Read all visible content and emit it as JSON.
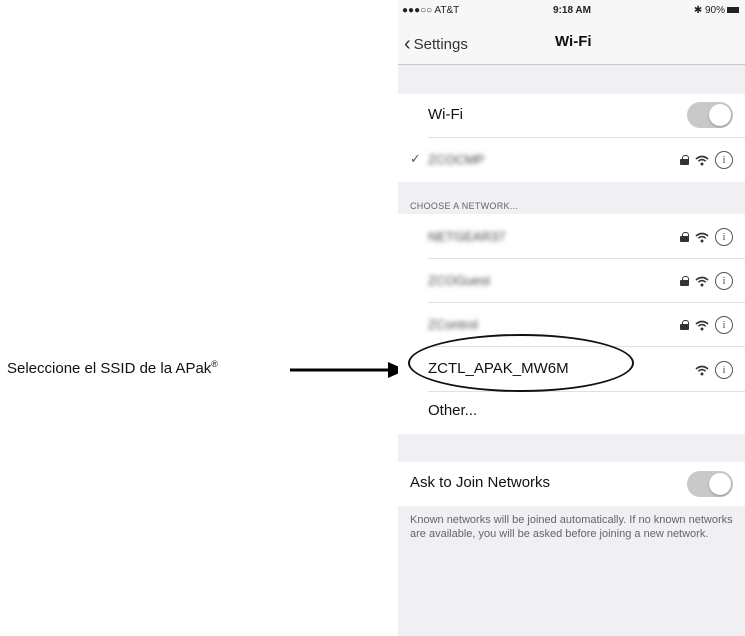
{
  "annotation": {
    "label": "Seleccione el SSID de la APak",
    "mark": "®"
  },
  "status_bar": {
    "carrier": "●●●○○ AT&T",
    "time": "9:18 AM",
    "battery": "✱ 90%"
  },
  "nav": {
    "back_label": "Settings",
    "title": "Wi-Fi"
  },
  "wifi": {
    "label": "Wi-Fi",
    "enabled": true,
    "connected": {
      "name": "ZCOCMP",
      "checkmark": "✓",
      "secured": true
    }
  },
  "choose_network": {
    "header": "CHOOSE A NETWORK...",
    "networks": [
      {
        "name": "NETGEAR37",
        "secured": true,
        "blurred": true
      },
      {
        "name": "ZCOGuest",
        "secured": true,
        "blurred": true
      },
      {
        "name": "ZControl",
        "secured": true,
        "blurred": true
      },
      {
        "name": "ZCTL_APAK_MW6M",
        "secured": false,
        "blurred": false
      }
    ],
    "other_label": "Other..."
  },
  "ask_to_join": {
    "label": "Ask to Join Networks",
    "enabled": true,
    "description": "Known networks will be joined automatically. If no known networks are available, you will be asked before joining a new network."
  },
  "icons": {
    "wifi": "wifi-icon",
    "lock": "lock-icon",
    "info": "info-icon",
    "back": "chevron-left-icon"
  },
  "colors": {
    "toggle": "#c9c9c9",
    "background": "#efeff4"
  }
}
